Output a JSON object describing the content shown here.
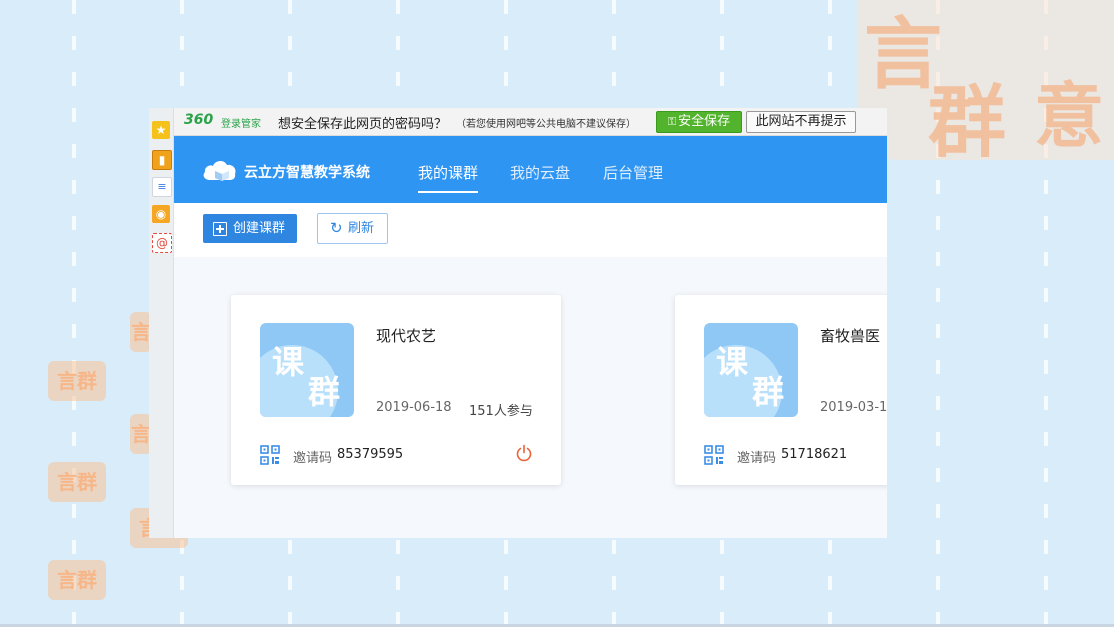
{
  "background": {
    "brand_logo_text": [
      "言",
      "群",
      "意"
    ],
    "stamp_text": "言群意"
  },
  "password_bar": {
    "brand": "360",
    "brand_sub": "登录管家",
    "question": "想安全保存此网页的密码吗？",
    "note": "（若您使用网吧等公共电脑不建议保存）",
    "save_label": "安全保存",
    "never_label": "此网站不再提示"
  },
  "sidebar_icons": [
    "star-icon",
    "bookmark-icon",
    "document-icon",
    "weibo-icon",
    "email-icon"
  ],
  "nav": {
    "brand": "云立方智慧教学系统",
    "items": [
      {
        "label": "我的课群",
        "active": true
      },
      {
        "label": "我的云盘",
        "active": false
      },
      {
        "label": "后台管理",
        "active": false
      }
    ]
  },
  "toolbar": {
    "create_label": "创建课群",
    "refresh_label": "刷新"
  },
  "cards": [
    {
      "thumb_text": [
        "课",
        "群"
      ],
      "title": "现代农艺",
      "date": "2019-06-18",
      "participants": "151人参与",
      "invite_label": "邀请码",
      "invite_code": "85379595"
    },
    {
      "thumb_text": [
        "课",
        "群"
      ],
      "title": "畜牧兽医",
      "date": "2019-03-1",
      "participants": "",
      "invite_label": "邀请码",
      "invite_code": "51718621"
    }
  ],
  "colors": {
    "nav_bg": "#2f95f3",
    "primary_button": "#2f86e0",
    "save_button": "#52b32c",
    "power_icon": "#e8623a",
    "qr_icon": "#3b8ee6"
  }
}
